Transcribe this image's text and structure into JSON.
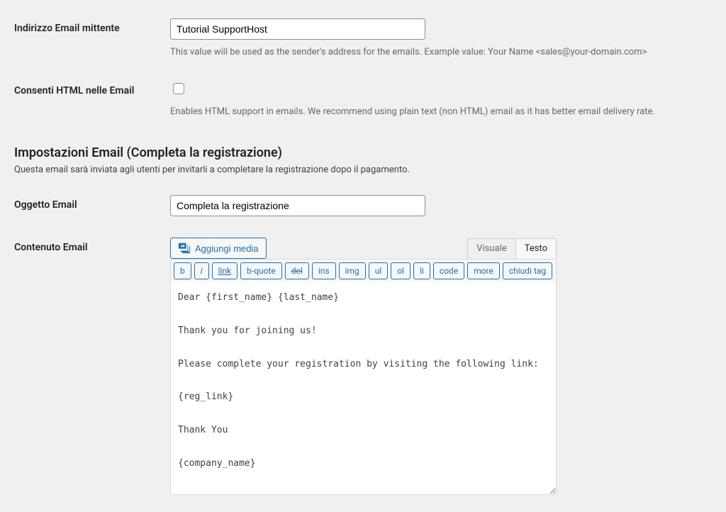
{
  "fields": {
    "sender": {
      "label": "Indirizzo Email mittente",
      "value": "Tutorial SupportHost",
      "help": "This value will be used as the sender's address for the emails. Example value: Your Name <sales@your-domain.com>"
    },
    "allow_html": {
      "label": "Consenti HTML nelle Email",
      "help": "Enables HTML support in emails. We recommend using plain text (non HTML) email as it has better email delivery rate."
    },
    "subject": {
      "label": "Oggetto Email",
      "value": "Completa la registrazione"
    },
    "content": {
      "label": "Contenuto Email",
      "value": "Dear {first_name} {last_name}\n\nThank you for joining us!\n\nPlease complete your registration by visiting the following link:\n\n{reg_link}\n\nThank You\n\n{company_name}"
    }
  },
  "section": {
    "title": "Impostazioni Email (Completa la registrazione)",
    "desc": "Questa email sarà inviata agli utenti per invitarli a completare la registrazione dopo il pagamento."
  },
  "editor": {
    "add_media": "Aggiungi media",
    "tabs": {
      "visual": "Visuale",
      "text": "Testo"
    },
    "buttons": [
      "b",
      "i",
      "link",
      "b-quote",
      "del",
      "ins",
      "img",
      "ul",
      "ol",
      "li",
      "code",
      "more",
      "chiudi tag"
    ]
  }
}
